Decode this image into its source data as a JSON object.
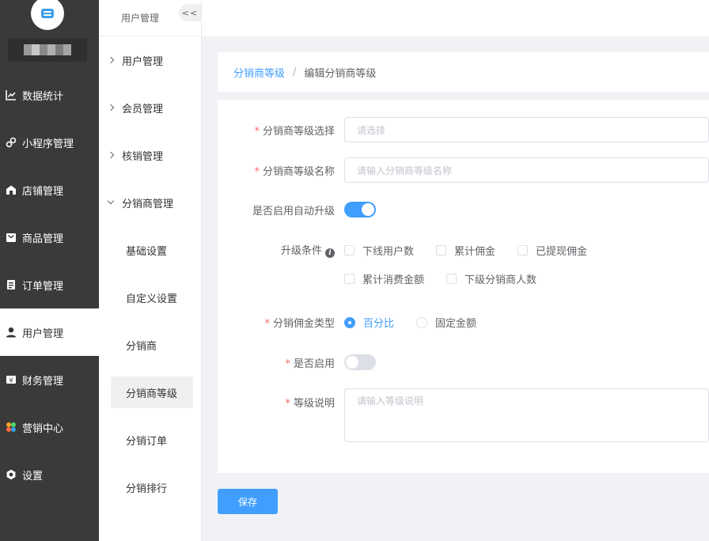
{
  "sidebar": {
    "items": [
      {
        "label": "数据统计",
        "icon": "chart-line-icon"
      },
      {
        "label": "小程序管理",
        "icon": "mini-program-icon"
      },
      {
        "label": "店铺管理",
        "icon": "shop-icon"
      },
      {
        "label": "商品管理",
        "icon": "goods-icon"
      },
      {
        "label": "订单管理",
        "icon": "order-icon"
      },
      {
        "label": "用户管理",
        "icon": "user-icon"
      },
      {
        "label": "财务管理",
        "icon": "finance-icon"
      },
      {
        "label": "营销中心",
        "icon": "marketing-icon"
      },
      {
        "label": "设置",
        "icon": "settings-icon"
      }
    ],
    "active_index": 5
  },
  "subsidebar": {
    "title": "用户管理",
    "collapse_label": "<<",
    "groups": [
      {
        "label": "用户管理"
      },
      {
        "label": "会员管理"
      },
      {
        "label": "核销管理"
      },
      {
        "label": "分销商管理"
      }
    ],
    "items": [
      {
        "label": "基础设置"
      },
      {
        "label": "自定义设置"
      },
      {
        "label": "分销商"
      },
      {
        "label": "分销商等级"
      },
      {
        "label": "分销订单"
      },
      {
        "label": "分销排行"
      }
    ]
  },
  "breadcrumb": {
    "parent": "分销商等级",
    "separator": "/",
    "current": "编辑分销商等级"
  },
  "form": {
    "level_select": {
      "label": "分销商等级选择",
      "placeholder": "请选择"
    },
    "level_name": {
      "label": "分销商等级名称",
      "placeholder": "请输入分销商等级名称"
    },
    "auto_upgrade": {
      "label": "是否启用自动升级"
    },
    "upgrade_conditions": {
      "label": "升级条件",
      "options": [
        "下线用户数",
        "累计佣金",
        "已提现佣金",
        "累计消费金额",
        "下级分销商人数"
      ]
    },
    "commission_type": {
      "label": "分销佣金类型",
      "options": [
        "百分比",
        "固定金额"
      ]
    },
    "enabled": {
      "label": "是否启用"
    },
    "description": {
      "label": "等级说明",
      "placeholder": "请输入等级说明"
    }
  },
  "save_label": "保存",
  "colors": {
    "primary": "#409eff",
    "sidebar_bg": "#3a3a3a",
    "required": "#f56c6c"
  }
}
